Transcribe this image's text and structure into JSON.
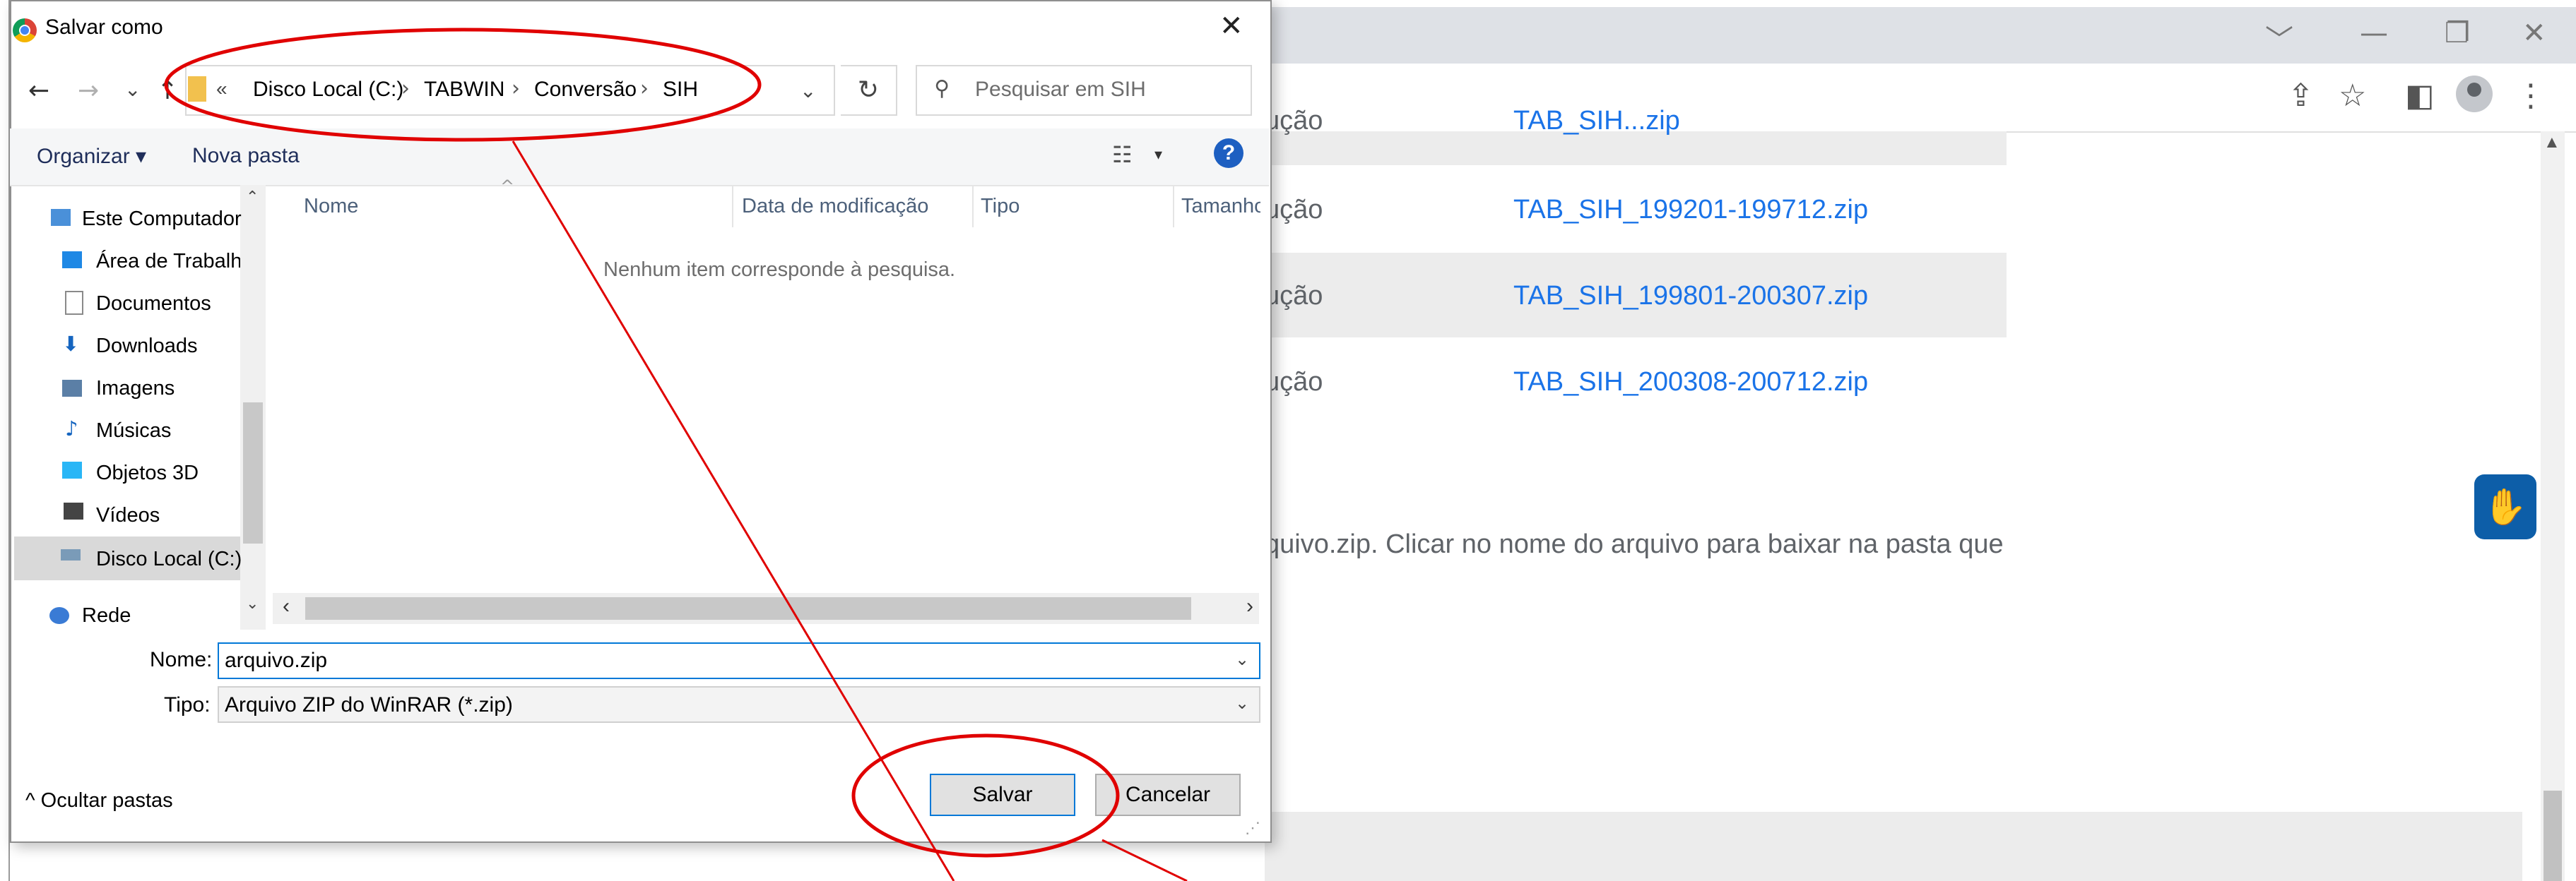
{
  "chrome": {
    "window_controls": [
      "﹀",
      "—",
      "❐",
      "✕"
    ],
    "toolbar_icons": [
      "⇪",
      "☆",
      "◧",
      "⋮"
    ]
  },
  "page": {
    "rows": [
      {
        "label": "ução",
        "file": "TAB_SIH...zip"
      },
      {
        "label": "ução",
        "file": "TAB_SIH_199201-199712.zip"
      },
      {
        "label": "ução",
        "file": "TAB_SIH_199801-200307.zip"
      },
      {
        "label": "ução",
        "file": "TAB_SIH_200308-200712.zip"
      }
    ],
    "instruction": "quivo.zip. Clicar no nome do arquivo para baixar na pasta que",
    "a11y_glyph": "✋"
  },
  "dialog": {
    "title": "Salvar como",
    "close": "✕",
    "nav": {
      "back": "←",
      "forward": "→",
      "recent": "⌄",
      "up": "↑"
    },
    "address": {
      "more": "«",
      "crumbs": [
        "Disco Local (C:)",
        "TABWIN",
        "Conversão",
        "SIH"
      ],
      "separator": "›",
      "dropdown": "⌄",
      "refresh": "↻"
    },
    "search": {
      "placeholder": "Pesquisar em SIH"
    },
    "commands": {
      "organize": "Organizar ▾",
      "new_folder": "Nova pasta",
      "view_icon": "☷",
      "view_drop": "▾",
      "help": "?"
    },
    "tree": [
      {
        "label": "Este Computador",
        "icon_color": "#4a90d9"
      },
      {
        "label": "Área de Trabalho",
        "icon_color": "#1e88e5"
      },
      {
        "label": "Documentos",
        "icon_color": "#8a8a8a"
      },
      {
        "label": "Downloads",
        "icon_color": "#1565c0"
      },
      {
        "label": "Imagens",
        "icon_color": "#5b7fa6"
      },
      {
        "label": "Músicas",
        "icon_color": "#1565c0"
      },
      {
        "label": "Objetos 3D",
        "icon_color": "#29b6f6"
      },
      {
        "label": "Vídeos",
        "icon_color": "#444444"
      },
      {
        "label": "Disco Local (C:)",
        "icon_color": "#7a9bb8"
      },
      {
        "label": "Rede",
        "icon_color": "#3a7bd5"
      }
    ],
    "tree_scroll": {
      "up": "⌃",
      "down": "⌄"
    },
    "columns": [
      "Nome",
      "Data de modificação",
      "Tipo",
      "Tamanho"
    ],
    "sort_indicator": "^",
    "empty_message": "Nenhum item corresponde à pesquisa.",
    "hscroll": {
      "left": "‹",
      "right": "›"
    },
    "name_label": "Nome:",
    "name_value": "arquivo.zip",
    "type_label": "Tipo:",
    "type_value": "Arquivo ZIP do WinRAR (*.zip)",
    "field_chevron": "⌄",
    "hide_folders": "^  Ocultar pastas",
    "save_button": "Salvar",
    "cancel_button": "Cancelar",
    "grip": "⋰"
  },
  "colors": {
    "link": "#1a73e8",
    "annotation": "#e00000",
    "accent": "#0078d7"
  }
}
